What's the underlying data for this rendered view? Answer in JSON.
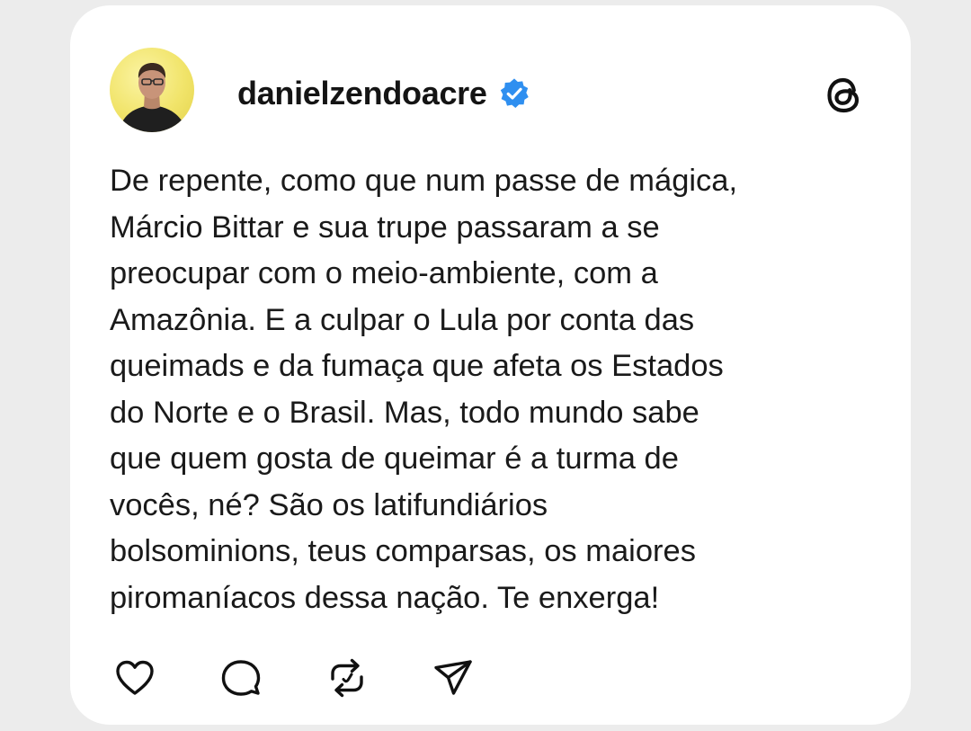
{
  "post": {
    "username": "danielzendoacre",
    "verified": true,
    "text": "De repente, como que num passe de mágica,\nMárcio Bittar e sua trupe passaram a se\npreocupar com o meio-ambiente, com a\nAmazônia. E a culpar o Lula por conta das\nqueimads e da fumaça que afeta os Estados\ndo Norte e o Brasil. Mas, todo mundo sabe\nque quem gosta de queimar é  a turma de\nvocês, né? São os latifundiários\nbolsominions, teus comparsas, os maiores\npiromaníacos dessa nação. Te enxerga!"
  },
  "icons": {
    "verified": "verified-badge-icon",
    "threads": "threads-logo-icon",
    "like": "heart-icon",
    "reply": "comment-icon",
    "repost": "repost-icon",
    "share": "send-icon"
  },
  "colors": {
    "verified_badge": "#2f8ff0",
    "text": "#1a1a1a",
    "card_background": "#ffffff",
    "page_background": "#ececec",
    "avatar_background": "#f1e46a"
  }
}
